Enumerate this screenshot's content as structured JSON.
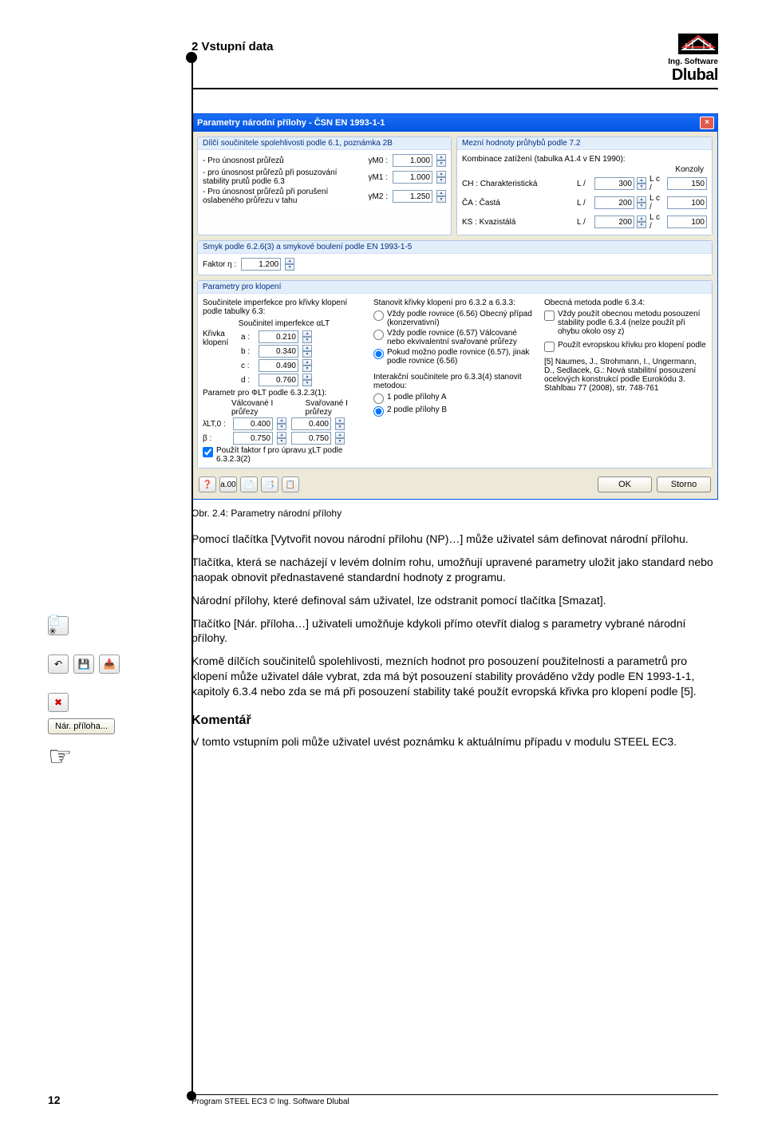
{
  "header": {
    "section": "2 Vstupní data",
    "brand_top": "Ing. Software",
    "brand": "Dlubal"
  },
  "dialog": {
    "title": "Parametry národní přílohy - ČSN EN 1993-1-1",
    "group1": {
      "title": "Dílčí součinitele spolehlivosti podle 6.1, poznámka 2B",
      "r1": "- Pro únosnost průřezů",
      "r2": "- pro únosnost průřezů při posuzování stability prutů podle 6.3",
      "r3": "- Pro únosnost průřezů při porušení oslabeného průřezu v tahu",
      "g0l": "γM0 :",
      "g0": "1.000",
      "g1l": "γM1 :",
      "g1": "1.000",
      "g2l": "γM2 :",
      "g2": "1.250"
    },
    "group2": {
      "title": "Mezní hodnoty průhybů podle 7.2",
      "sub": "Kombinace zatížení (tabulka A1.4 v EN 1990):",
      "head_k": "Konzoly",
      "r1l": "CH : Charakteristická",
      "r1a": "L /",
      "r1v": "300",
      "r1b": "L c /",
      "r1w": "150",
      "r2l": "ČA : Častá",
      "r2a": "L /",
      "r2v": "200",
      "r2b": "L c /",
      "r2w": "100",
      "r3l": "KS : Kvazistálá",
      "r3a": "L /",
      "r3v": "200",
      "r3b": "L c /",
      "r3w": "100"
    },
    "group_shear": {
      "title": "Smyk podle 6.2.6(3) a smykové boulení podle EN 1993-1-5",
      "lbl": "Faktor    η :",
      "val": "1.200"
    },
    "group_klop": {
      "title": "Parametry pro klopení",
      "left": {
        "sub1": "Součinitele imperfekce pro křivky klopení podle tabulky 6.3:",
        "sub2": "Součinitel imperfekce αLT",
        "label_curve": "Křivka klopení",
        "a": "a :",
        "av": "0.210",
        "b": "b :",
        "bv": "0.340",
        "c": "c :",
        "cv": "0.490",
        "d": "d :",
        "dv": "0.760",
        "sub3": "Parametr pro ΦLT podle 6.3.2.3(1):",
        "col1": "Válcované I průřezy",
        "col2": "Svařované I průřezy",
        "l1": "λ̄LT,0 :",
        "v11": "0.400",
        "v12": "0.400",
        "l2": "β :",
        "v21": "0.750",
        "v22": "0.750",
        "chk": "Použít faktor f pro úpravu χLT podle 6.3.2.3(2)"
      },
      "mid": {
        "sub": "Stanovit křivky klopení pro 6.3.2 a 6.3.3:",
        "r1": "Vždy podle rovnice (6.56) Obecný případ (konzervativní)",
        "r2": "Vždy podle rovnice (6.57) Válcované nebo ekvivalentní svařované průřezy",
        "r3": "Pokud možno podle rovnice (6.57), jinak podle rovnice (6.56)",
        "sub2": "Interakční součinitele pro 6.3.3(4) stanovit metodou:",
        "r4": "1 podle přílohy A",
        "r5": "2 podle přílohy B"
      },
      "right": {
        "sub": "Obecná metoda podle 6.3.4:",
        "c1": "Vždy použít obecnou metodu posouzení stability podle 6.3.4 (nelze použít při ohybu okolo osy z)",
        "c2": "Použít evropskou křivku pro klopení podle",
        "ref": "[5] Naumes, J., Strohmann, I., Ungermann, D., Sedlacek, G.: Nová stabilitní posouzení ocelových konstrukcí podle Eurokódu 3. Stahlbau 77 (2008), str. 748-761"
      }
    },
    "footer_icons": [
      "❓",
      "a.00",
      "📄",
      "📑",
      "📋"
    ],
    "ok": "OK",
    "cancel": "Storno"
  },
  "caption": "Obr. 2.4: Parametry národní přílohy",
  "gutter": {
    "nar_btn": "Nár. příloha..."
  },
  "body": {
    "p1": "Pomocí tlačítka [Vytvořit novou národní přílohu (NP)…] může uživatel sám definovat národní přílohu.",
    "p2": "Tlačítka, která se nacházejí v levém dolním rohu, umožňují upravené parametry uložit jako standard nebo naopak obnovit přednastavené standardní hodnoty z programu.",
    "p3": "Národní přílohy, které definoval sám uživatel, lze odstranit pomocí tlačítka [Smazat].",
    "p4": "Tlačítko [Nár. příloha…] uživateli umožňuje kdykoli přímo otevřít dialog s parametry vybrané národní přílohy.",
    "p5": "Kromě dílčích součinitelů spolehlivosti, mezních hodnot pro posouzení použitelnosti a parametrů pro klopení může uživatel dále vybrat, zda má být posouzení stability prováděno vždy podle EN 1993-1-1, kapitoly 6.3.4 nebo zda se má při posouzení stability také použít evropská křivka pro klopení podle [5].",
    "h3": "Komentář",
    "p6": "V tomto vstupním poli může uživatel uvést poznámku k aktuálnímu případu v modulu STEEL EC3."
  },
  "footer": {
    "page": "12",
    "text": "Program STEEL EC3 © Ing. Software Dlubal"
  }
}
